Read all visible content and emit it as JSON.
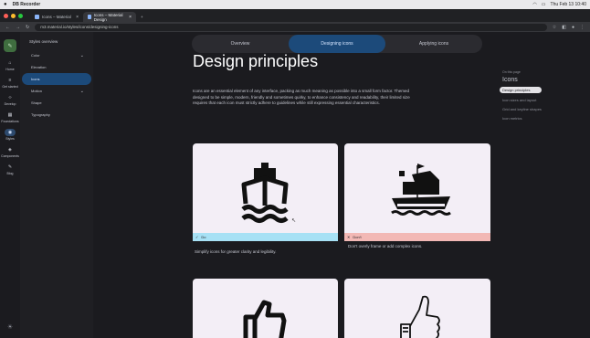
{
  "mac": {
    "apple": "",
    "app": "DB Recorder",
    "status_right": "Thu Feb 13  10:40"
  },
  "browser": {
    "tabs": [
      {
        "label": "Icons – Material",
        "active": false
      },
      {
        "label": "Icons – Material Design",
        "active": true
      }
    ],
    "url": "m3.material.io/styles/icons/designing-icons",
    "nav": {
      "back": "←",
      "forward": "→",
      "reload": "↻"
    }
  },
  "rail": {
    "fab_icon": "edit-icon",
    "items": [
      {
        "label": "Home",
        "icon": "⌂",
        "active": false
      },
      {
        "label": "Get started",
        "icon": "≡",
        "active": false
      },
      {
        "label": "Develop",
        "icon": "‹›",
        "active": false
      },
      {
        "label": "Foundations",
        "icon": "▦",
        "active": false
      },
      {
        "label": "Styles",
        "icon": "◉",
        "active": true
      },
      {
        "label": "Components",
        "icon": "◈",
        "active": false
      },
      {
        "label": "Blog",
        "icon": "✎",
        "active": false
      }
    ],
    "bottom_icon": "☀"
  },
  "sidebar": {
    "title": "Styles overview",
    "items": [
      {
        "label": "Color",
        "chevron": "⌄",
        "active": false,
        "sub": false
      },
      {
        "label": "Elevation",
        "chevron": "",
        "active": false,
        "sub": false
      },
      {
        "label": "Icons",
        "chevron": "",
        "active": true,
        "sub": false
      },
      {
        "label": "Motion",
        "chevron": "⌄",
        "active": false,
        "sub": false
      },
      {
        "label": "Shape",
        "chevron": "",
        "active": false,
        "sub": false
      },
      {
        "label": "Typography",
        "chevron": "",
        "active": false,
        "sub": false
      }
    ]
  },
  "page_tabs": [
    {
      "label": "Overview",
      "active": false
    },
    {
      "label": "Designing icons",
      "active": true
    },
    {
      "label": "Applying icons",
      "active": false
    }
  ],
  "main": {
    "heading": "Design principles",
    "intro": "Icons are an essential element of any interface, packing as much meaning as possible into a small form factor. Themed designed to be simple, modern, friendly and sometimes quirky, to enhance consistency and readability, their limited size requires that each icon must strictly adhere to guidelines while still expressing essential characteristics.",
    "cards": [
      {
        "bar_label": "Do",
        "bar_icon": "✓",
        "caption": "Simplify icons for greater clarity and legibility.",
        "bar_color": "#a7e1f5",
        "icon": "ship-simple-icon"
      },
      {
        "bar_label": "Don't",
        "bar_icon": "✕",
        "caption": "Don't overly frame or add complex icons.",
        "bar_color": "#f2b8b5",
        "icon": "ship-complex-icon"
      },
      {
        "icon": "thumbs-up-simple-icon"
      },
      {
        "icon": "thumbs-up-complex-icon"
      }
    ]
  },
  "toc": {
    "label": "On this page",
    "title": "Icons",
    "items": [
      {
        "label": "Design principles",
        "active": true
      },
      {
        "label": "Icon sizes and layout",
        "active": false
      },
      {
        "label": "Grid and keyline shapes",
        "active": false
      },
      {
        "label": "Icon metrics",
        "active": false
      }
    ]
  },
  "colors": {
    "accent": "#1c4a7a",
    "do": "#a7e1f5",
    "dont": "#f2b8b5",
    "card": "#f3eef6",
    "background": "#1b1b1f"
  }
}
